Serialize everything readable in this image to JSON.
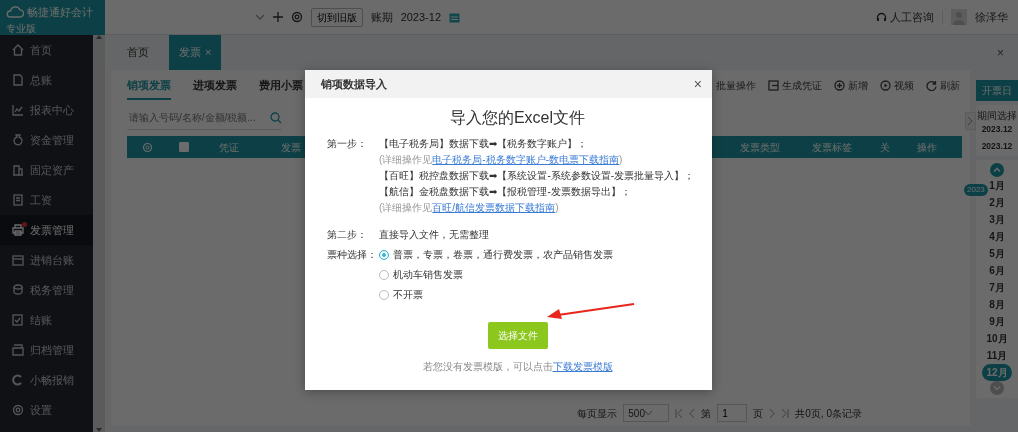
{
  "app": {
    "logo": "畅捷通好会计",
    "edition": "专业版"
  },
  "topbar": {
    "switch_button": "切到旧版",
    "period_label": "账期",
    "period": "2023-12",
    "support": "人工咨询",
    "user": "徐泽华"
  },
  "sidebar": {
    "items": [
      {
        "label": "首页",
        "selected": false,
        "dot": false
      },
      {
        "label": "总账",
        "selected": false,
        "dot": false
      },
      {
        "label": "报表中心",
        "selected": false,
        "dot": false
      },
      {
        "label": "资金管理",
        "selected": false,
        "dot": false
      },
      {
        "label": "固定资产",
        "selected": false,
        "dot": false
      },
      {
        "label": "工资",
        "selected": false,
        "dot": false
      },
      {
        "label": "发票管理",
        "selected": true,
        "dot": true
      },
      {
        "label": "进销台账",
        "selected": false,
        "dot": false
      },
      {
        "label": "税务管理",
        "selected": false,
        "dot": false
      },
      {
        "label": "结账",
        "selected": false,
        "dot": false
      },
      {
        "label": "归档管理",
        "selected": false,
        "dot": false
      },
      {
        "label": "小畅报销",
        "selected": false,
        "dot": false
      },
      {
        "label": "设置",
        "selected": false,
        "dot": false
      }
    ]
  },
  "page_tabs": [
    {
      "label": "首页",
      "selected": false
    },
    {
      "label": "发票",
      "selected": true,
      "close": "×"
    }
  ],
  "window_close": "×",
  "subtabs": [
    {
      "label": "销项发票",
      "selected": true
    },
    {
      "label": "进项发票",
      "selected": false
    },
    {
      "label": "费用小票",
      "selected": false
    }
  ],
  "toolbar": [
    "批量操作",
    "生成凭证",
    "新增",
    "视频",
    "刷新"
  ],
  "search": {
    "placeholder": "请输入号码/名称/金额/税额..."
  },
  "table": {
    "columns": [
      {
        "kind": "settings"
      },
      {
        "kind": "checkbox",
        "checked": false
      },
      {
        "kind": "text",
        "label": "凭证"
      },
      {
        "kind": "text",
        "label": "发票"
      },
      {
        "kind": "gap"
      },
      {
        "kind": "text",
        "label": "发票类型"
      },
      {
        "kind": "text",
        "label": "发票标签"
      },
      {
        "kind": "text",
        "label": "关"
      },
      {
        "kind": "text",
        "label": "操作"
      }
    ]
  },
  "pagination": {
    "page_size_label": "每页显示",
    "page_size": "500",
    "page_prefix": "第",
    "page": "1",
    "page_suffix": "页",
    "summary": "共0页, 0条记录"
  },
  "period_panel": {
    "button": "开票日",
    "label": "期间选择",
    "from": "2023.12",
    "to": "2023.12",
    "year": "2023",
    "months": [
      {
        "label": "1月",
        "selected": false
      },
      {
        "label": "2月",
        "selected": false
      },
      {
        "label": "3月",
        "selected": false
      },
      {
        "label": "4月",
        "selected": false
      },
      {
        "label": "5月",
        "selected": false
      },
      {
        "label": "6月",
        "selected": false
      },
      {
        "label": "7月",
        "selected": false
      },
      {
        "label": "8月",
        "selected": false
      },
      {
        "label": "9月",
        "selected": false
      },
      {
        "label": "10月",
        "selected": false
      },
      {
        "label": "11月",
        "selected": false
      },
      {
        "label": "12月",
        "selected": true
      }
    ]
  },
  "dialog": {
    "title": "销项数据导入",
    "close": "×",
    "heading": "导入您的Excel文件",
    "step1_label": "第一步：",
    "step1_lines": [
      {
        "kind": "main",
        "text": "【电子税务局】数据下载➡【税务数字账户】；"
      },
      {
        "kind": "note",
        "prefix": "(详细操作见",
        "link": "电子税务局-税务数字账户-数电票下载指南",
        "suffix": ")"
      },
      {
        "kind": "main",
        "text": "【百旺】税控盘数据下载➡【系统设置-系统参数设置-发票批量导入】；"
      },
      {
        "kind": "main",
        "text": "【航信】金税盘数据下载➡【报税管理-发票数据导出】；"
      },
      {
        "kind": "note",
        "prefix": "(详细操作见",
        "link": "百旺/航信发票数据下载指南",
        "suffix": ")"
      }
    ],
    "step2_label": "第二步：",
    "step2_text": "直接导入文件，无需整理",
    "type_label": "票种选择：",
    "options": [
      {
        "label": "普票，专票，卷票，通行费发票，农产品销售发票",
        "selected": true
      },
      {
        "label": "机动车销售发票",
        "selected": false
      },
      {
        "label": "不开票",
        "selected": false
      }
    ],
    "button": "选择文件",
    "footer_text": "若您没有发票模版，可以点击",
    "footer_link": "下载发票模版"
  }
}
